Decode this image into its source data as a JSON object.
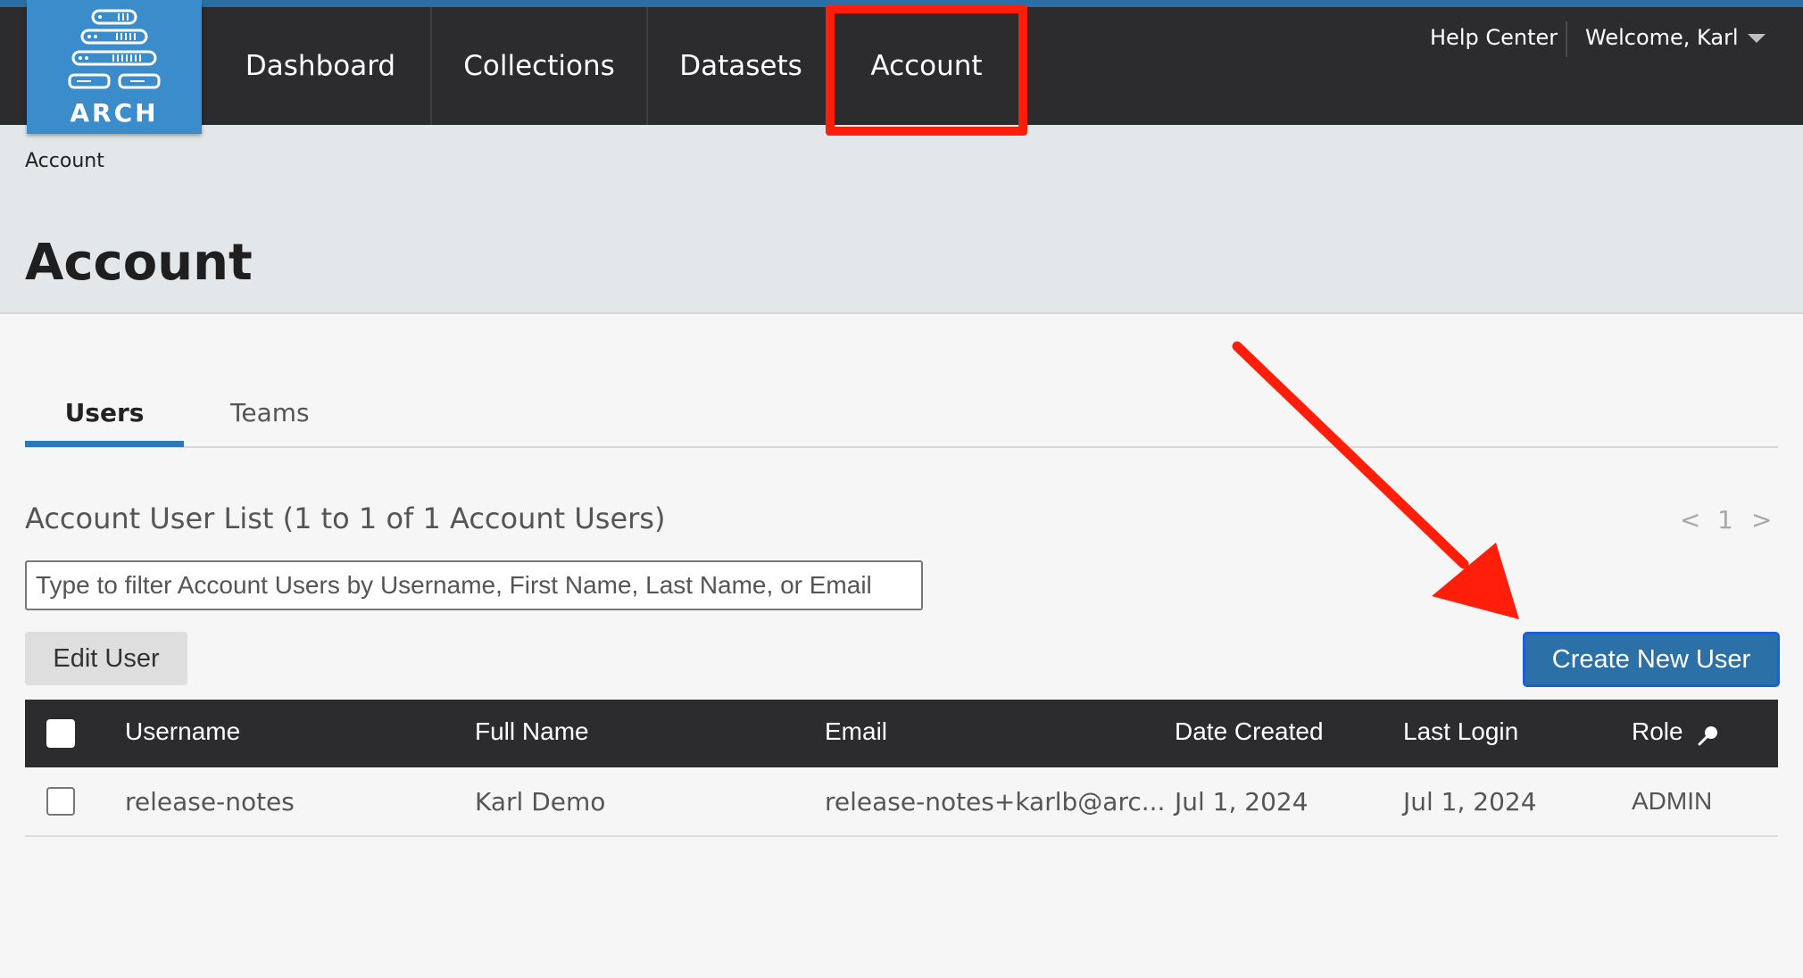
{
  "app": {
    "logo_text": "ARCH"
  },
  "nav": {
    "items": [
      {
        "label": "Dashboard"
      },
      {
        "label": "Collections"
      },
      {
        "label": "Datasets"
      },
      {
        "label": "Account"
      }
    ],
    "help_label": "Help Center",
    "welcome_label": "Welcome, Karl"
  },
  "breadcrumb": "Account",
  "page_title": "Account",
  "tabs": [
    {
      "label": "Users"
    },
    {
      "label": "Teams"
    }
  ],
  "list": {
    "title": "Account User List (1 to 1 of 1 Account Users)",
    "pager": {
      "prev": "<",
      "page": "1",
      "next": ">"
    },
    "filter_placeholder": "Type to filter Account Users by Username, First Name, Last Name, or Email"
  },
  "buttons": {
    "edit_user": "Edit User",
    "create_new_user": "Create New User"
  },
  "table": {
    "columns": [
      "Username",
      "Full Name",
      "Email",
      "Date Created",
      "Last Login",
      "Role"
    ],
    "rows": [
      {
        "username": "release-notes",
        "full_name": "Karl Demo",
        "email": "release-notes+karlb@arc...",
        "date_created": "Jul 1, 2024",
        "last_login": "Jul 1, 2024",
        "role": "ADMIN"
      }
    ]
  },
  "colors": {
    "nav_bg": "#2c2b2d",
    "accent": "#2a70a6",
    "logo_bg": "#3a8cca",
    "annotation": "#ff1e0a"
  },
  "icons": {
    "logo": "server-stack-icon",
    "user_menu": "caret-down-icon",
    "role_filter": "magnifier-icon"
  }
}
